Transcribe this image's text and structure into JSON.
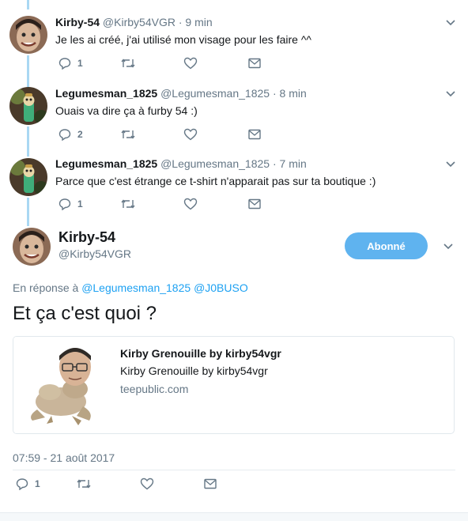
{
  "colors": {
    "accent": "#1da1f2",
    "follow_button": "#5fb3ef",
    "thread_line": "#aad8f3",
    "muted": "#657786"
  },
  "thread": [
    {
      "name": "Kirby-54",
      "handle": "@Kirby54VGR",
      "dot": "·",
      "time": "9 min",
      "text": "Je les ai créé, j'ai utilisé mon visage pour les faire ^^",
      "reply_count": "1",
      "avatar": "face-avatar"
    },
    {
      "name": "Legumesman_1825",
      "handle": "@Legumesman_1825",
      "dot": "·",
      "time": "8 min",
      "text": "Ouais va dire ça à furby 54 :)",
      "reply_count": "2",
      "avatar": "toy-avatar"
    },
    {
      "name": "Legumesman_1825",
      "handle": "@Legumesman_1825",
      "dot": "·",
      "time": "7 min",
      "text": "Parce que c'est étrange ce t-shirt n'apparait pas sur ta boutique :)",
      "reply_count": "1",
      "avatar": "toy-avatar"
    }
  ],
  "main": {
    "name": "Kirby-54",
    "handle": "@Kirby54VGR",
    "follow_label": "Abonné",
    "reply_prefix": "En réponse à",
    "mention_1": "@Legumesman_1825",
    "mention_2": "@J0BUSO",
    "text": "Et ça c'est quoi ?",
    "card": {
      "title": "Kirby Grenouille by kirby54vgr",
      "description": "Kirby Grenouille by kirby54vgr",
      "domain": "teepublic.com"
    },
    "timestamp": "07:59 - 21 août 2017",
    "reply_count": "1"
  }
}
